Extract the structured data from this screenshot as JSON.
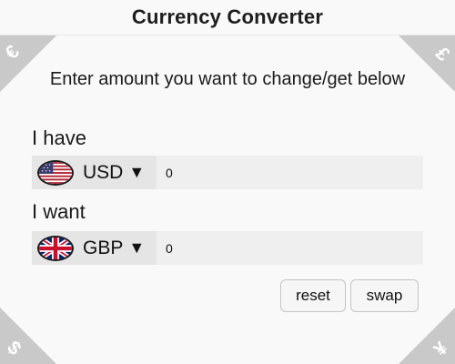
{
  "app": {
    "title": "Currency Converter",
    "instruction": "Enter amount you want to change/get below"
  },
  "corners": {
    "top_left": "€",
    "top_right": "£",
    "bottom_left": "$",
    "bottom_right": "¥"
  },
  "have": {
    "label": "I have",
    "currency": "USD",
    "caret": "▼",
    "flag_icon": "us-flag-icon",
    "amount": "0"
  },
  "want": {
    "label": "I want",
    "currency": "GBP",
    "caret": "▼",
    "flag_icon": "uk-flag-icon",
    "amount": "0"
  },
  "buttons": {
    "reset_label": "reset",
    "swap_label": "swap"
  },
  "colors": {
    "corner": "#c9c9c9",
    "background": "#f9f9f9",
    "row": "#efefef",
    "select": "#e5e5e5"
  }
}
